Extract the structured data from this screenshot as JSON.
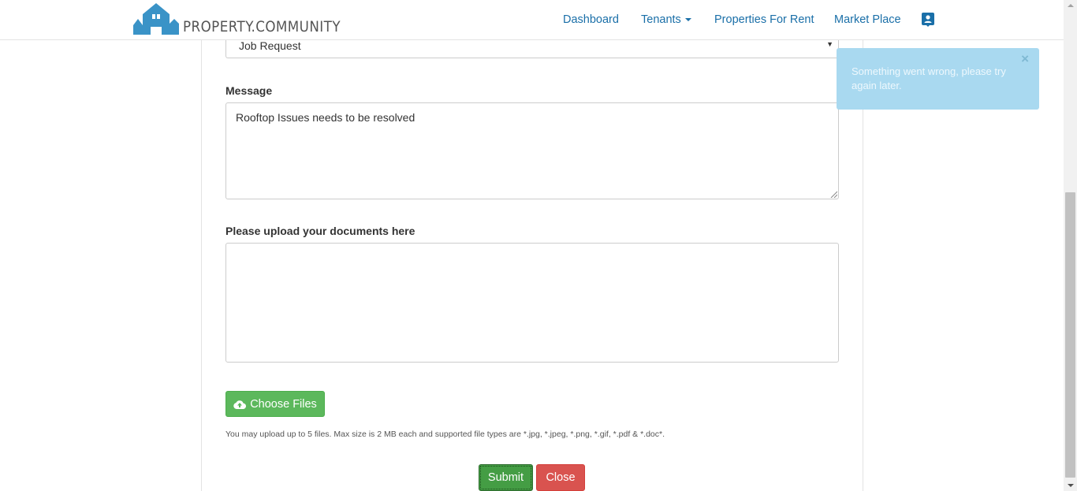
{
  "brand": {
    "name": "PROPERTY.COMMUNITY",
    "color": "#3a93c7"
  },
  "nav": {
    "dashboard": "Dashboard",
    "tenants": "Tenants",
    "properties_for_rent": "Properties For Rent",
    "market_place": "Market Place",
    "profile_icon": "user-card-icon",
    "link_color": "#1a6fa8"
  },
  "form": {
    "request_type": {
      "selected": "Job Request"
    },
    "message": {
      "label": "Message",
      "value": "Rooftop Issues needs to be resolved"
    },
    "upload": {
      "label": "Please upload your documents here"
    },
    "choose_files": {
      "label": "Choose Files",
      "icon": "cloud-upload-icon"
    },
    "help_text": "You may upload up to 5 files. Max size is 2 MB each and supported file types are *.jpg, *.jpeg, *.png, *.gif, *.pdf & *.doc*.",
    "submit_label": "Submit",
    "close_label": "Close"
  },
  "toast": {
    "message": "Something went wrong, please try again later.",
    "close_symbol": "×",
    "color": "#a9d9f0"
  },
  "colors": {
    "success": "#5cb85c",
    "danger": "#d9534f"
  }
}
